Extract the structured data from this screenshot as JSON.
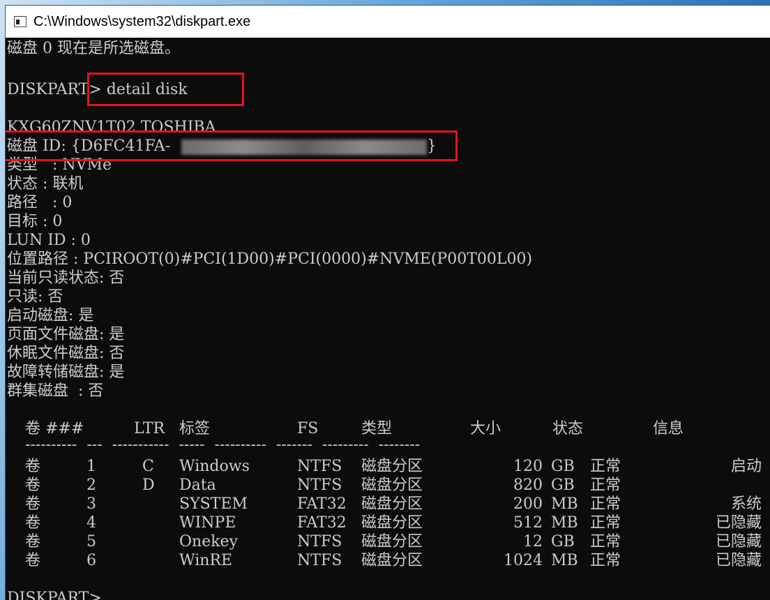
{
  "window": {
    "title": "C:\\Windows\\system32\\diskpart.exe"
  },
  "console": {
    "lines": [
      "磁盘 0 现在是所选磁盘。",
      "",
      "DISKPART> detail disk",
      "",
      "KXG60ZNV1T02 TOSHIBA",
      "磁盘 ID: {D6FC41FA-",
      "类型   : NVMe",
      "状态 : 联机",
      "路径   : 0",
      "目标 : 0",
      "LUN ID : 0",
      "位置路径 : PCIROOT(0)#PCI(1D00)#PCI(0000)#NVME(P00T00L00)",
      "当前只读状态: 否",
      "只读: 否",
      "启动磁盘: 是",
      "页面文件磁盘: 是",
      "休眠文件磁盘: 否",
      "故障转储磁盘: 是",
      "群集磁盘  : 否"
    ],
    "disk_id_close": "}",
    "prompt": "DISKPART>",
    "volume_table": {
      "headers": [
        "卷 ###",
        "LTR",
        "标签",
        "FS",
        "类型",
        "大小",
        "状态",
        "信息"
      ],
      "rows": [
        {
          "vol": "卷",
          "num": "1",
          "ltr": "C",
          "label": "Windows",
          "fs": "NTFS",
          "type": "磁盘分区",
          "size": "120",
          "unit": "GB",
          "status": "正常",
          "info": "启动"
        },
        {
          "vol": "卷",
          "num": "2",
          "ltr": "D",
          "label": "Data",
          "fs": "NTFS",
          "type": "磁盘分区",
          "size": "820",
          "unit": "GB",
          "status": "正常",
          "info": ""
        },
        {
          "vol": "卷",
          "num": "3",
          "ltr": "",
          "label": "SYSTEM",
          "fs": "FAT32",
          "type": "磁盘分区",
          "size": "200",
          "unit": "MB",
          "status": "正常",
          "info": "系统"
        },
        {
          "vol": "卷",
          "num": "4",
          "ltr": "",
          "label": "WINPE",
          "fs": "FAT32",
          "type": "磁盘分区",
          "size": "512",
          "unit": "MB",
          "status": "正常",
          "info": "已隐藏"
        },
        {
          "vol": "卷",
          "num": "5",
          "ltr": "",
          "label": "Onekey",
          "fs": "NTFS",
          "type": "磁盘分区",
          "size": "12",
          "unit": "GB",
          "status": "正常",
          "info": "已隐藏"
        },
        {
          "vol": "卷",
          "num": "6",
          "ltr": "",
          "label": "WinRE",
          "fs": "NTFS",
          "type": "磁盘分区",
          "size": "1024",
          "unit": "MB",
          "status": "正常",
          "info": "已隐藏"
        }
      ]
    }
  },
  "colors": {
    "console_bg": "#0c0c0c",
    "console_fg": "#cccccc",
    "highlight": "#e8121b"
  }
}
